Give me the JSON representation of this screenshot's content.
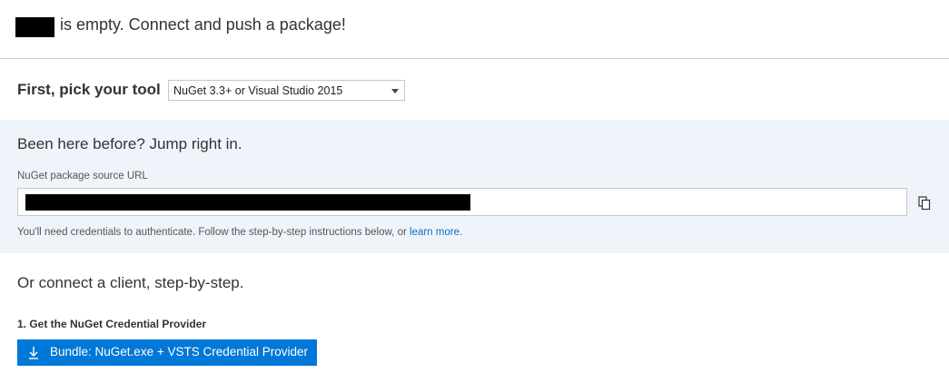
{
  "header": {
    "text": "is empty. Connect and push a package!"
  },
  "tool_picker": {
    "label": "First, pick your tool",
    "selected_value": "NuGet 3.3+ or Visual Studio 2015"
  },
  "quick_start": {
    "title": "Been here before? Jump right in.",
    "url_label": "NuGet package source URL",
    "help_text": "You'll need credentials to authenticate. Follow the step-by-step instructions below, or ",
    "help_link": "learn more",
    "help_end": "."
  },
  "step_by_step": {
    "title": "Or connect a client, step-by-step.",
    "step1_heading": "1. Get the NuGet Credential Provider",
    "bundle_button_label": "Bundle: NuGet.exe + VSTS Credential Provider"
  },
  "icons": {
    "copy": "copy-icon",
    "download": "download-icon",
    "dropdown": "chevron-down-icon"
  },
  "colors": {
    "accent": "#0078d7",
    "link": "#106ebe",
    "panel_bg": "#eff4fb"
  }
}
